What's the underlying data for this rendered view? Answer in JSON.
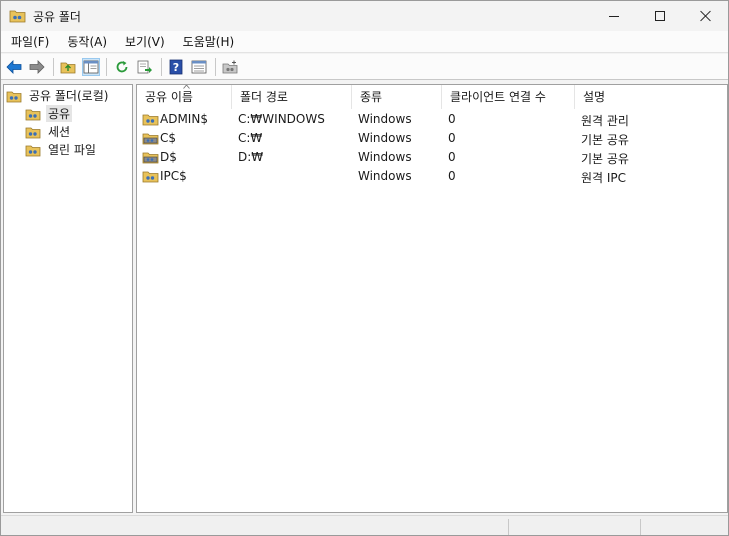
{
  "window": {
    "title": "공유 폴더"
  },
  "menu": [
    {
      "label": "파일(F)"
    },
    {
      "label": "동작(A)"
    },
    {
      "label": "보기(V)"
    },
    {
      "label": "도움말(H)"
    }
  ],
  "toolbar": {
    "icons": [
      "back-arrow-icon",
      "forward-arrow-icon",
      "up-folder-icon",
      "show-hide-tree-icon",
      "refresh-icon",
      "export-list-icon",
      "help-icon",
      "properties-icon",
      "new-share-icon"
    ]
  },
  "tree": {
    "root": "공유 폴더(로컬)",
    "items": [
      {
        "label": "공유"
      },
      {
        "label": "세션"
      },
      {
        "label": "열린 파일"
      }
    ]
  },
  "list": {
    "columns": [
      "공유 이름",
      "폴더 경로",
      "종류",
      "클라이언트 연결 수",
      "설명"
    ],
    "rows": [
      {
        "name": "ADMIN$",
        "path": "C:₩WINDOWS",
        "type": "Windows",
        "clients": "0",
        "desc": "원격 관리"
      },
      {
        "name": "C$",
        "path": "C:₩",
        "type": "Windows",
        "clients": "0",
        "desc": "기본 공유"
      },
      {
        "name": "D$",
        "path": "D:₩",
        "type": "Windows",
        "clients": "0",
        "desc": "기본 공유"
      },
      {
        "name": "IPC$",
        "path": "",
        "type": "Windows",
        "clients": "0",
        "desc": "원격 IPC"
      }
    ]
  },
  "colors": {
    "accent": "#cce4f7",
    "folder": "#e8c25a",
    "arrow": "#1e78d2"
  }
}
